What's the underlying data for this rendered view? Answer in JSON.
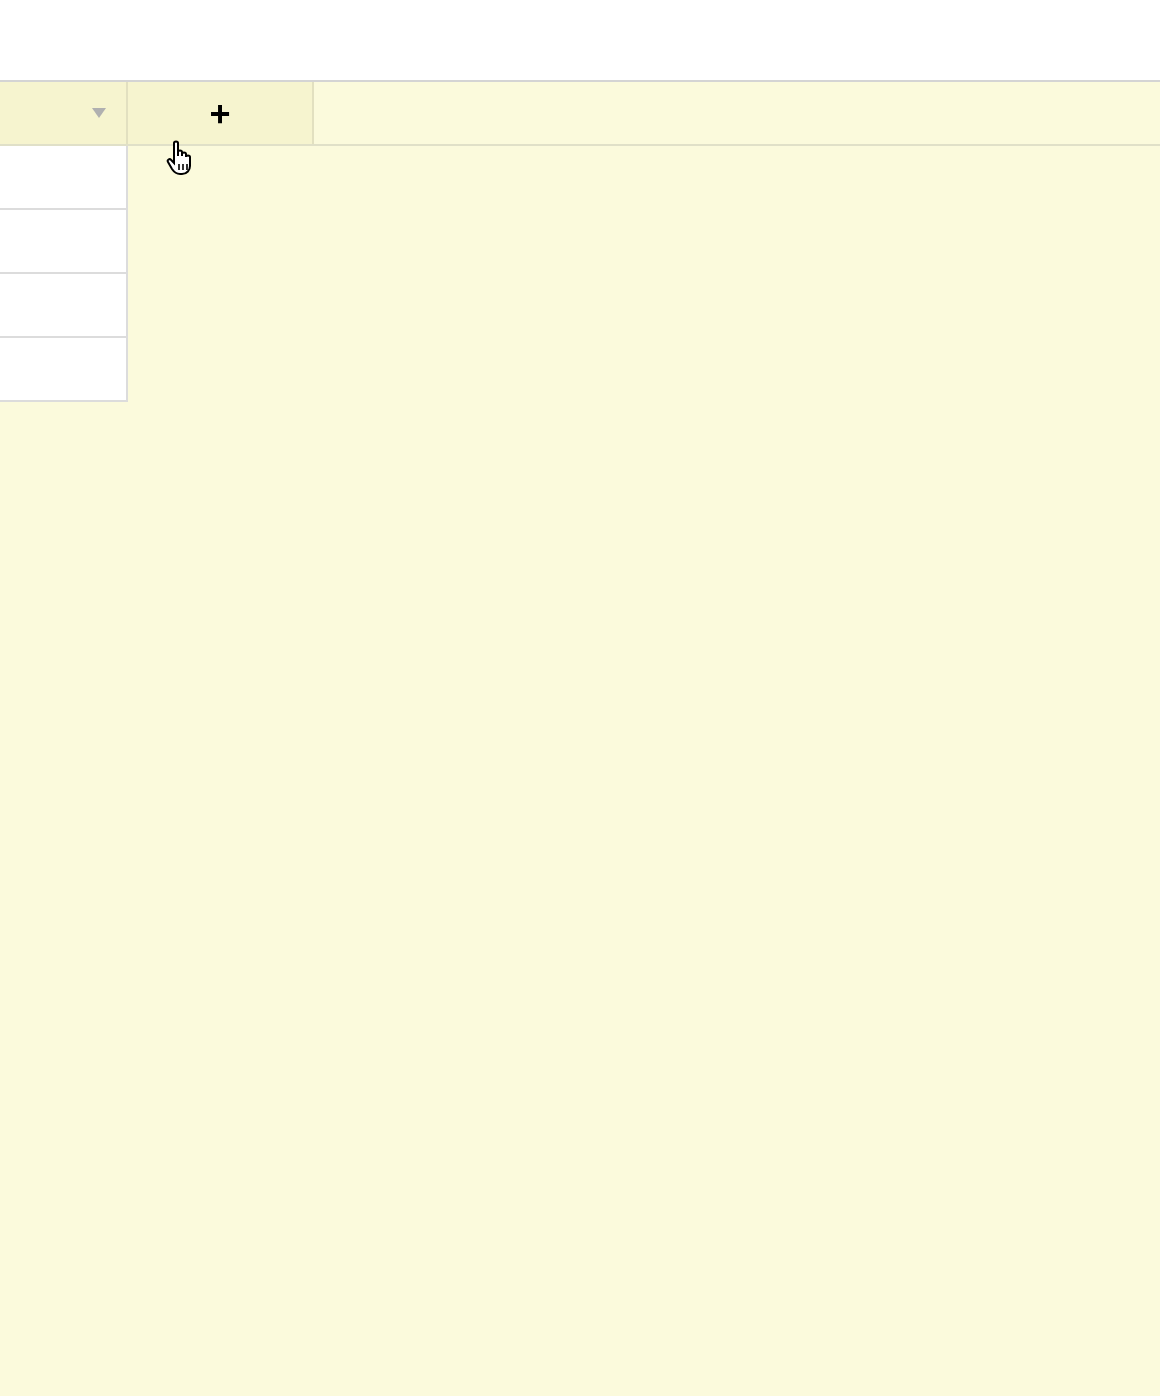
{
  "header": {
    "columns": [
      {
        "kind": "dropdown"
      }
    ],
    "add_button": {
      "label": "+"
    }
  },
  "rows": [
    {
      "kind": "blank"
    },
    {
      "kind": "blank"
    },
    {
      "kind": "blank"
    },
    {
      "kind": "blank"
    }
  ]
}
